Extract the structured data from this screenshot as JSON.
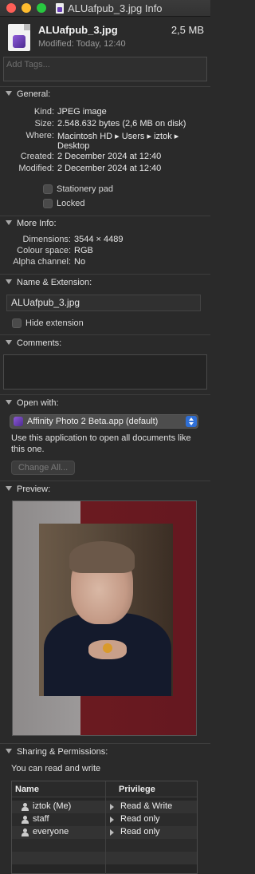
{
  "window": {
    "title": "ALUafpub_3.jpg Info"
  },
  "header": {
    "filename": "ALUafpub_3.jpg",
    "size": "2,5 MB",
    "modified": "Modified: Today, 12:40"
  },
  "tags": {
    "placeholder": "Add Tags..."
  },
  "general": {
    "heading": "General:",
    "kind_label": "Kind:",
    "kind": "JPEG image",
    "size_label": "Size:",
    "size": "2.548.632 bytes (2,6 MB on disk)",
    "where_label": "Where:",
    "where_line1": "Macintosh HD ▸ Users ▸ iztok ▸",
    "where_line2": "Desktop",
    "created_label": "Created:",
    "created": "2 December 2024 at 12:40",
    "modified_label": "Modified:",
    "modified": "2 December 2024 at 12:40",
    "stationery": "Stationery pad",
    "locked": "Locked"
  },
  "more_info": {
    "heading": "More Info:",
    "dimensions_label": "Dimensions:",
    "dimensions": "3544 × 4489",
    "colour_label": "Colour space:",
    "colour": "RGB",
    "alpha_label": "Alpha channel:",
    "alpha": "No"
  },
  "name_ext": {
    "heading": "Name & Extension:",
    "value": "ALUafpub_3.jpg",
    "hide_extension": "Hide extension"
  },
  "comments": {
    "heading": "Comments:"
  },
  "open_with": {
    "heading": "Open with:",
    "app": "Affinity Photo 2 Beta.app (default)",
    "description": "Use this application to open all documents like this one.",
    "change_all": "Change All..."
  },
  "preview": {
    "heading": "Preview:"
  },
  "sharing": {
    "heading": "Sharing & Permissions:",
    "summary": "You can read and write",
    "col_name": "Name",
    "col_privilege": "Privilege",
    "rows": [
      {
        "user": "iztok (Me)",
        "privilege": "Read & Write"
      },
      {
        "user": "staff",
        "privilege": "Read only"
      },
      {
        "user": "everyone",
        "privilege": "Read only"
      }
    ]
  }
}
